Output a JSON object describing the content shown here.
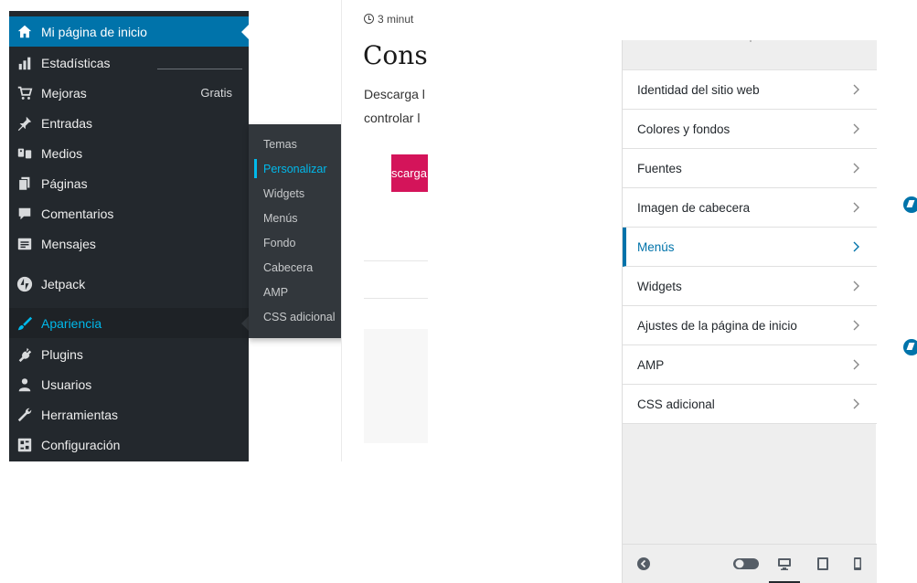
{
  "sidebar": {
    "items": [
      {
        "label": "Mi página de inicio",
        "icon": "home-icon"
      },
      {
        "label": "Estadísticas",
        "icon": "bar-chart-icon"
      },
      {
        "label": "Mejoras",
        "icon": "cart-icon",
        "badge": "Gratis"
      },
      {
        "label": "Entradas",
        "icon": "pin-icon"
      },
      {
        "label": "Medios",
        "icon": "media-icon"
      },
      {
        "label": "Páginas",
        "icon": "pages-icon"
      },
      {
        "label": "Comentarios",
        "icon": "comment-icon"
      },
      {
        "label": "Mensajes",
        "icon": "messages-icon"
      },
      {
        "label": "Jetpack",
        "icon": "jetpack-icon"
      },
      {
        "label": "Apariencia",
        "icon": "brush-icon"
      },
      {
        "label": "Plugins",
        "icon": "plugin-icon"
      },
      {
        "label": "Usuarios",
        "icon": "users-icon"
      },
      {
        "label": "Herramientas",
        "icon": "wrench-icon"
      },
      {
        "label": "Configuración",
        "icon": "settings-icon"
      }
    ]
  },
  "submenu": {
    "items": [
      "Temas",
      "Personalizar",
      "Widgets",
      "Menús",
      "Fondo",
      "Cabecera",
      "AMP",
      "CSS adicional"
    ]
  },
  "article": {
    "read_time": "3 minut",
    "title": "Cons",
    "line1": "Descarga l",
    "line2": "controlar l",
    "button_label": "scarga"
  },
  "customizer": {
    "items": [
      "Identidad del sitio web",
      "Colores y fondos",
      "Fuentes",
      "Imagen de cabecera",
      "Menús",
      "Widgets",
      "Ajustes de la página de inicio",
      "AMP",
      "CSS adicional"
    ],
    "active_item": "Menús"
  },
  "colors": {
    "sidebar_bg": "#23282d",
    "current_bg": "#0073aa",
    "highlight": "#00b9eb",
    "accent_button": "#d4145a"
  }
}
